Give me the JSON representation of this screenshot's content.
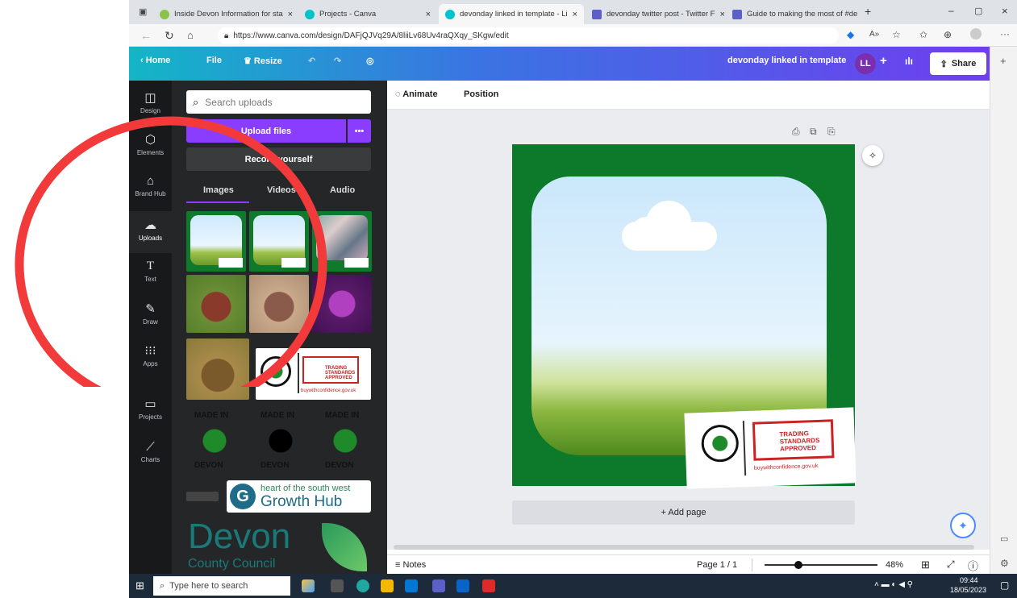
{
  "browser": {
    "tabs": [
      {
        "label": "Inside Devon Information for sta",
        "color": "#8bc34a"
      },
      {
        "label": "Projects - Canva",
        "color": "#00c4cc"
      },
      {
        "label": "devonday linked in template - Li",
        "color": "#00c4cc"
      },
      {
        "label": "devonday twitter post - Twitter F",
        "color": "#5b5fc7"
      },
      {
        "label": "Guide to making the most of #de",
        "color": "#5b5fc7"
      }
    ],
    "url": "https://www.canva.com/design/DAFjQJVq29A/8liiLv68Uv4raQXqy_SKgw/edit"
  },
  "header": {
    "home": "Home",
    "file": "File",
    "resize": "Resize",
    "doc_title": "devonday linked in template",
    "avatar": "LL",
    "plus": "+",
    "share": "Share"
  },
  "rail": [
    {
      "label": "Design",
      "icon": "◫"
    },
    {
      "label": "Elements",
      "icon": "⬡"
    },
    {
      "label": "Brand Hub",
      "icon": "⌂"
    },
    {
      "label": "Uploads",
      "icon": "☁"
    },
    {
      "label": "Text",
      "icon": "T"
    },
    {
      "label": "Draw",
      "icon": "✎"
    },
    {
      "label": "Apps",
      "icon": "∷"
    },
    {
      "label": "Projects",
      "icon": "▢"
    },
    {
      "label": "Charts",
      "icon": "∿"
    }
  ],
  "panel": {
    "search_placeholder": "Search uploads",
    "upload_btn": "Upload files",
    "more": "•••",
    "record_btn": "Record yourself",
    "tabs": [
      "Images",
      "Videos",
      "Audio"
    ],
    "made_in": "MADE IN",
    "devon": "DEVON",
    "trading": "TRADING STANDARDS APPROVED",
    "bwc": "buywithconfidence.gov.uk",
    "growth1": "heart of the south west",
    "growth2": "Growth Hub",
    "devon_big": "Devon",
    "county": "County Council"
  },
  "toolbar": {
    "animate": "Animate",
    "position": "Position"
  },
  "canvas": {
    "add_page": "+ Add page",
    "notes": "Notes",
    "page": "Page 1 / 1",
    "zoom": "48%"
  },
  "taskbar": {
    "search": "Type here to search",
    "time": "09:44",
    "date": "18/05/2023"
  },
  "annotation_color": "#f23a3a"
}
